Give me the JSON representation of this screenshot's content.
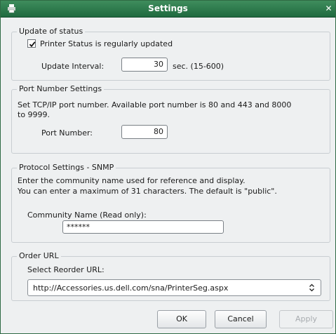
{
  "window": {
    "title": "Settings"
  },
  "update_status": {
    "legend": "Update of status",
    "checkbox_label": "Printer Status is regularly updated",
    "checkbox_checked": true,
    "interval_label": "Update Interval:",
    "interval_value": "30",
    "interval_hint": "sec. (15-600)"
  },
  "port_settings": {
    "legend": "Port Number Settings",
    "description_line1": "Set TCP/IP port number. Available port number is 80 and 443 and 8000",
    "description_line2": "to 9999.",
    "port_label": "Port Number:",
    "port_value": "80"
  },
  "snmp": {
    "legend": "Protocol Settings - SNMP",
    "description_line1": "Enter the community name used for reference and display.",
    "description_line2": "You can enter a maximum of 31 characters. The default is \"public\".",
    "community_label": "Community Name (Read only):",
    "community_value": "******"
  },
  "order_url": {
    "legend": "Order URL",
    "select_label": "Select Reorder URL:",
    "selected_value": "http://Accessories.us.dell.com/sna/PrinterSeg.aspx"
  },
  "buttons": {
    "ok": "OK",
    "cancel": "Cancel",
    "apply": "Apply"
  }
}
